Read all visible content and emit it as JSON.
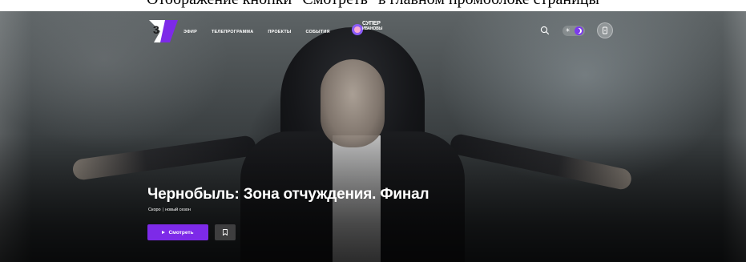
{
  "caption": {
    "text": "Отображение кнопки \"Смотреть\" в главном промоблоке страницы"
  },
  "header": {
    "logo_icon": "channel-3-logo-icon",
    "nav": [
      {
        "label": "ЭФИР",
        "active": true
      },
      {
        "label": "ТЕЛЕПРОГРАММА",
        "active": false
      },
      {
        "label": "ПРОЕКТЫ",
        "active": false
      },
      {
        "label": "СОБЫТИЯ",
        "active": false
      }
    ],
    "promo_logo": {
      "line1": "СУПЕР",
      "line2": "ИВАНОВЫ"
    },
    "search_icon": "search-icon",
    "theme_toggle": {
      "mode": "dark",
      "sun_icon": "sun-icon",
      "moon_icon": "moon-icon",
      "accent": "#7c3aed"
    },
    "login_icon": "user-login-icon"
  },
  "hero": {
    "title": "Чернобыль: Зона отчуждения. Финал",
    "status": "Скоро",
    "separator": "|",
    "season": "новый сезон",
    "watch_button": {
      "label": "Смотреть",
      "icon": "play-icon",
      "color": "#7d2ae8"
    },
    "bookmark_icon": "bookmark-icon"
  }
}
